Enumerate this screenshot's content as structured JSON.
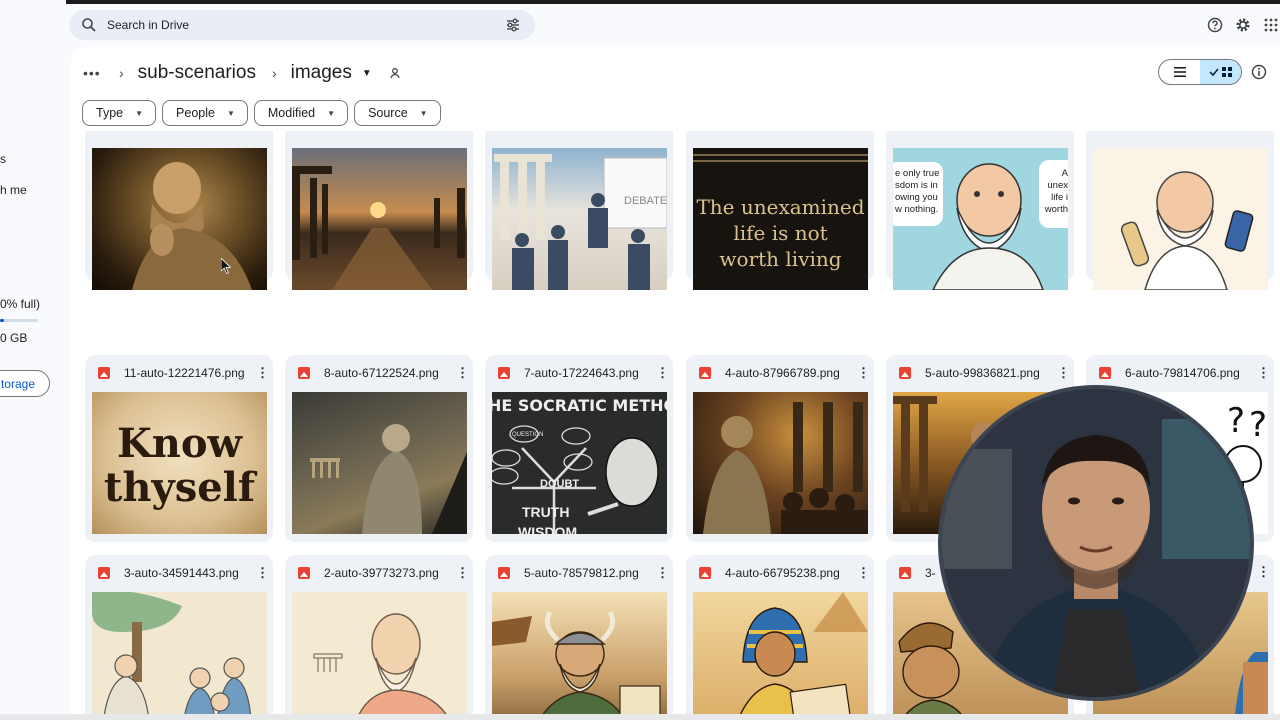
{
  "sidebar": {
    "fragments": [
      "s",
      "h me",
      "0% full)",
      "0 GB"
    ],
    "storage_button": "torage"
  },
  "search": {
    "placeholder": "Search in Drive"
  },
  "breadcrumb": {
    "parent": "sub-scenarios",
    "current": "images"
  },
  "filters": [
    "Type",
    "People",
    "Modified",
    "Source"
  ],
  "files": {
    "row1": [
      {
        "name": "",
        "thumb": "socrates-statue"
      },
      {
        "name": "",
        "thumb": "ruins-sunset"
      },
      {
        "name": "",
        "thumb": "debate-class",
        "thumb_text": "DEBATE"
      },
      {
        "name": "",
        "thumb": "quote-card",
        "thumb_text": [
          "The unexamined",
          "life is not",
          "worth living"
        ]
      },
      {
        "name": "",
        "thumb": "cartoon-philosopher",
        "thumb_text_left": [
          "e only true",
          "sdom is in",
          "owing you",
          "w nothing."
        ],
        "thumb_text_right": [
          "A",
          "unex",
          "life i",
          "worth"
        ]
      },
      {
        "name": "",
        "thumb": "cartoon-phone"
      }
    ],
    "row2": [
      {
        "name": "11-auto-12221476.png",
        "thumb": "know-thyself",
        "thumb_text": [
          "Know",
          "thyself"
        ]
      },
      {
        "name": "8-auto-67122524.png",
        "thumb": "philosopher-ruins"
      },
      {
        "name": "7-auto-17224643.png",
        "thumb": "socratic-method",
        "thumb_text": [
          "HE SOCRATIC METHO",
          "QUESTION",
          "DOUBT",
          "TRUTH",
          "WISDOM"
        ]
      },
      {
        "name": "4-auto-87966789.png",
        "thumb": "socrates-crowd"
      },
      {
        "name": "5-auto-99836821.png",
        "thumb": "socrates-temple"
      },
      {
        "name": "6-auto-79814706.png",
        "thumb": "question-stickman"
      }
    ],
    "row3": [
      {
        "name": "3-auto-34591443.png",
        "thumb": "students-tree"
      },
      {
        "name": "2-auto-39773273.png",
        "thumb": "thinker-sketch"
      },
      {
        "name": "5-auto-78579812.png",
        "thumb": "viking-map"
      },
      {
        "name": "4-auto-66795238.png",
        "thumb": "pharaoh-map"
      },
      {
        "name": "3-",
        "thumb": "pirate-map"
      },
      {
        "name": "",
        "thumb": "egypt-map"
      }
    ]
  },
  "colors": {
    "accent": "#0b57d0",
    "selected_view": "#c2e7ff",
    "image_file_icon": "#ea4335",
    "card_bg": "#eef1f6"
  }
}
